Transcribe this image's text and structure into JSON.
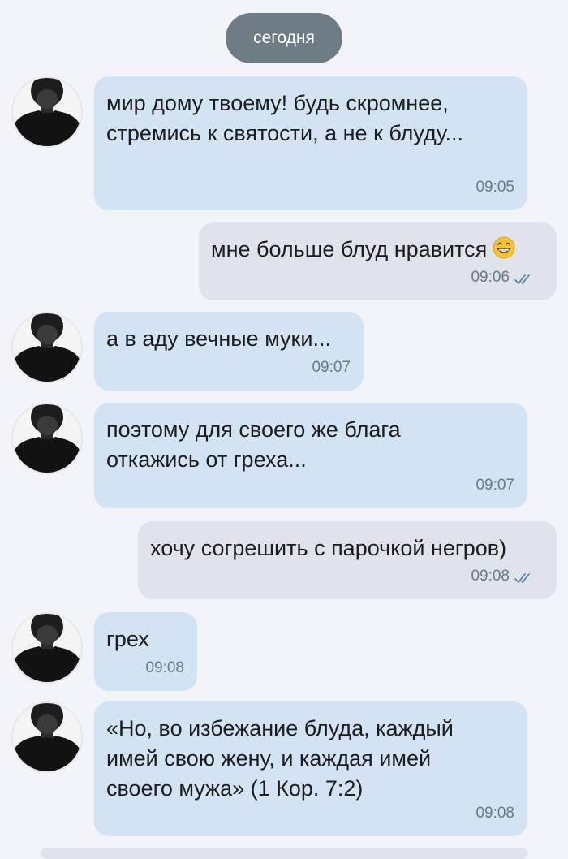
{
  "chat": {
    "date_separator": "сегодня",
    "messages": [
      {
        "direction": "in",
        "lines": [
          "мир дому твоему! будь скромнее,",
          "стремись к святости, а не к блуду..."
        ],
        "time": "09:05"
      },
      {
        "direction": "out",
        "text": "мне больше блуд нравится",
        "emoji": "grinning-face-emoji",
        "time": "09:06",
        "status": "read"
      },
      {
        "direction": "in",
        "lines": [
          "а в аду вечные муки..."
        ],
        "time": "09:07"
      },
      {
        "direction": "in",
        "lines": [
          "поэтому для своего же блага",
          "откажись от греха..."
        ],
        "time": "09:07"
      },
      {
        "direction": "out",
        "text": "хочу согрешить с парочкой негров)",
        "time": "09:08",
        "status": "read"
      },
      {
        "direction": "in",
        "lines": [
          "грех"
        ],
        "time": "09:08"
      },
      {
        "direction": "in",
        "lines": [
          "«Но, во избежание блуда, каждый",
          "имей свою жену, и каждая имей",
          "своего мужа» (1 Кор. 7:2)"
        ],
        "time": "09:08"
      }
    ]
  },
  "colors": {
    "background": "#f3f3fa",
    "incoming_bubble": "#d3e3f4",
    "outgoing_bubble": "#e0e4ea",
    "date_pill": "#6d7c85",
    "timestamp": "#6b7a84",
    "read_checks": "#4a7fb5"
  }
}
